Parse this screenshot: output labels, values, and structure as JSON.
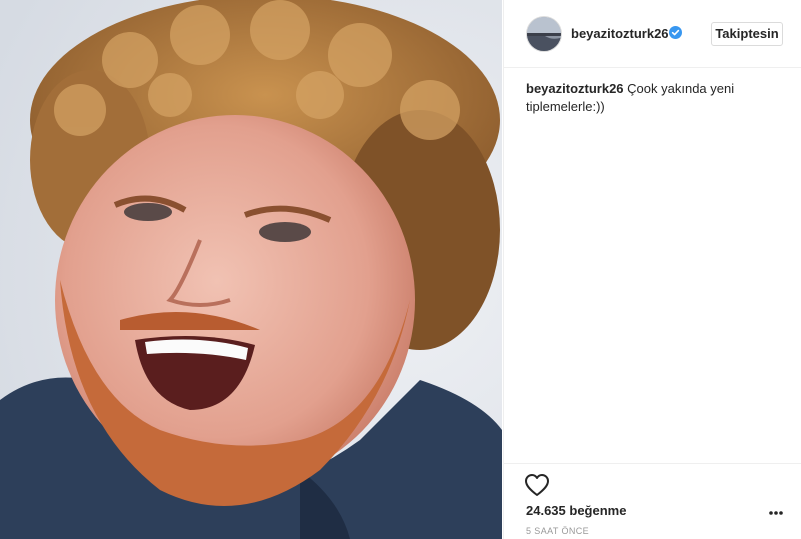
{
  "post": {
    "username": "beyazitozturk26",
    "follow_label": "Takiptesin",
    "caption_user": "beyazitozturk26",
    "caption_text": "Çook yakında yeni tiplemelerle:))",
    "likes": "24.635 beğenme",
    "time": "5 SAAT ÖNCE"
  },
  "icons": {
    "verified": "verified-badge-icon",
    "like": "heart-icon",
    "more": "more-options-icon"
  },
  "colors": {
    "verified_blue": "#3897f0",
    "text": "#262626",
    "muted": "#999999",
    "border": "#efefef"
  }
}
